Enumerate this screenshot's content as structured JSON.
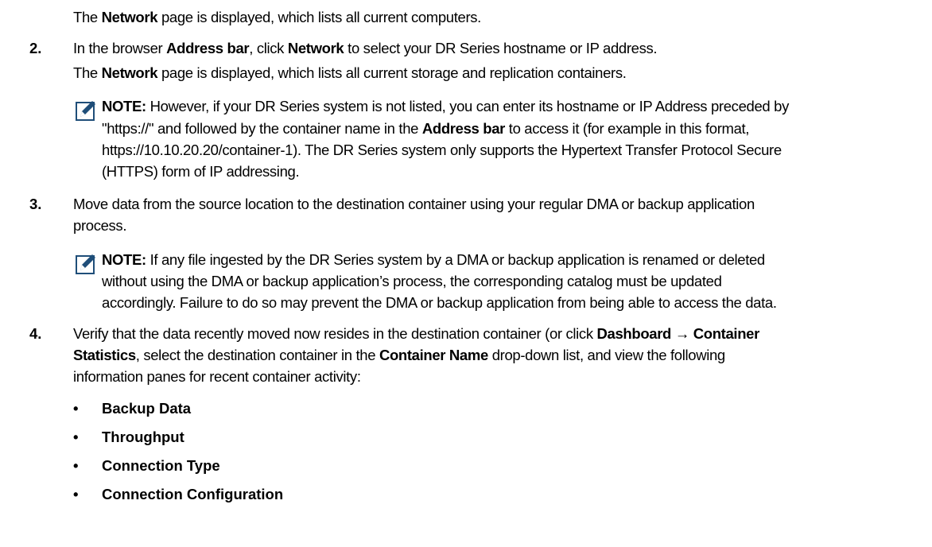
{
  "intro": {
    "pre": "The ",
    "b1": "Network",
    "post": " page is displayed, which lists all current computers."
  },
  "steps": [
    {
      "number": "2.",
      "line1": {
        "a": "In the browser ",
        "b1": "Address bar",
        "c": ", click ",
        "b2": "Network",
        "d": " to select your DR Series hostname or IP address."
      },
      "line2": {
        "a": "The ",
        "b1": "Network",
        "c": " page is displayed, which lists all current storage and replication containers."
      }
    },
    {
      "number": "3.",
      "line1": "Move data from the source location to the destination container using your regular DMA or backup application",
      "line2": "process."
    },
    {
      "number": "4.",
      "line1": {
        "a": "Verify that the data recently moved now resides in the destination container (or click ",
        "b1": "Dashboard",
        "arrow": " → ",
        "b2": "Container"
      },
      "line2": {
        "b1": "Statistics",
        "a": ", select the destination container in the ",
        "b2": "Container Name",
        "c": " drop-down list, and view the following"
      },
      "line3": "information panes for recent container activity:"
    }
  ],
  "note1": {
    "label": "NOTE:",
    "line1": " However, if your DR Series system is not listed, you can enter its hostname or IP Address preceded by",
    "line2a": "\"https://\" and followed by the container name in the ",
    "line2b": "Address bar",
    "line2c": " to access it (for example in this format,",
    "line3": "https://10.10.20.20/container-1). The DR Series system only supports the Hypertext Transfer Protocol Secure",
    "line4": "(HTTPS) form of IP addressing."
  },
  "note2": {
    "label": "NOTE:",
    "line1": " If any file ingested by the DR Series system by a DMA or backup application is renamed or deleted",
    "line2": "without using the DMA or backup application’s process, the corresponding catalog must be updated",
    "line3": "accordingly. Failure to do so may prevent the DMA or backup application from being able to access the data."
  },
  "bullets": [
    "Backup Data",
    "Throughput",
    "Connection Type",
    "Connection Configuration"
  ],
  "colors": {
    "text": "#000000",
    "icon": "#1f4e79"
  },
  "icons": {
    "note": "pencil-note-icon",
    "bullet": "bullet-icon"
  }
}
